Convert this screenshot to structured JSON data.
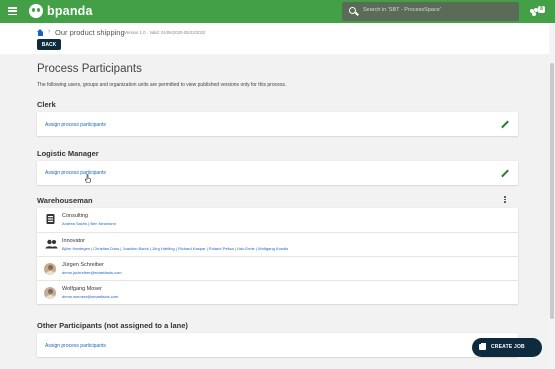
{
  "header": {
    "brand": "bpanda",
    "search_placeholder": "Search in 'SBT - ProcessSpace'",
    "notification_count": "8",
    "colors": {
      "topbar": "#43a047",
      "primary_dark": "#0d2a3f",
      "link": "#1e63c4"
    }
  },
  "breadcrumb": {
    "home_icon": "home-icon",
    "title": "Our product shipping",
    "meta": "Version 1.0 · Valid: 01/06/2020-05/22/2022"
  },
  "actions": {
    "back_label": "BACK",
    "create_job_label": "CREATE JOB"
  },
  "page": {
    "title": "Process Participants",
    "description": "The following users, groups and organization units are permitted to view published versions only for this process."
  },
  "sections": [
    {
      "title": "Clerk",
      "assign_label": "Assign process participants"
    },
    {
      "title": "Logistic Manager",
      "assign_label": "Assign process participants"
    },
    {
      "title": "Warehouseman",
      "members": [
        {
          "name": "Consulting",
          "detail": "Andrea Sachs | Ben Neumann",
          "icon": "org-unit-icon"
        },
        {
          "name": "Innovator",
          "detail": "Björn Hardegen | Christian Doss | Joachim Barck | Jörg Härtling | Richard Kaspar | Roland Peltsa | Udo Ende | Wolfgang Kondis",
          "icon": "group-icon"
        },
        {
          "name": "Jürgen Schreiber",
          "detail": "demo.jschreiber@smartfacts.com",
          "icon": "avatar"
        },
        {
          "name": "Wolfgang Moser",
          "detail": "demo.wmoser@smartfacts.com",
          "icon": "avatar"
        }
      ]
    },
    {
      "title": "Other Participants (not assigned to a lane)",
      "assign_label": "Assign process participants"
    }
  ]
}
